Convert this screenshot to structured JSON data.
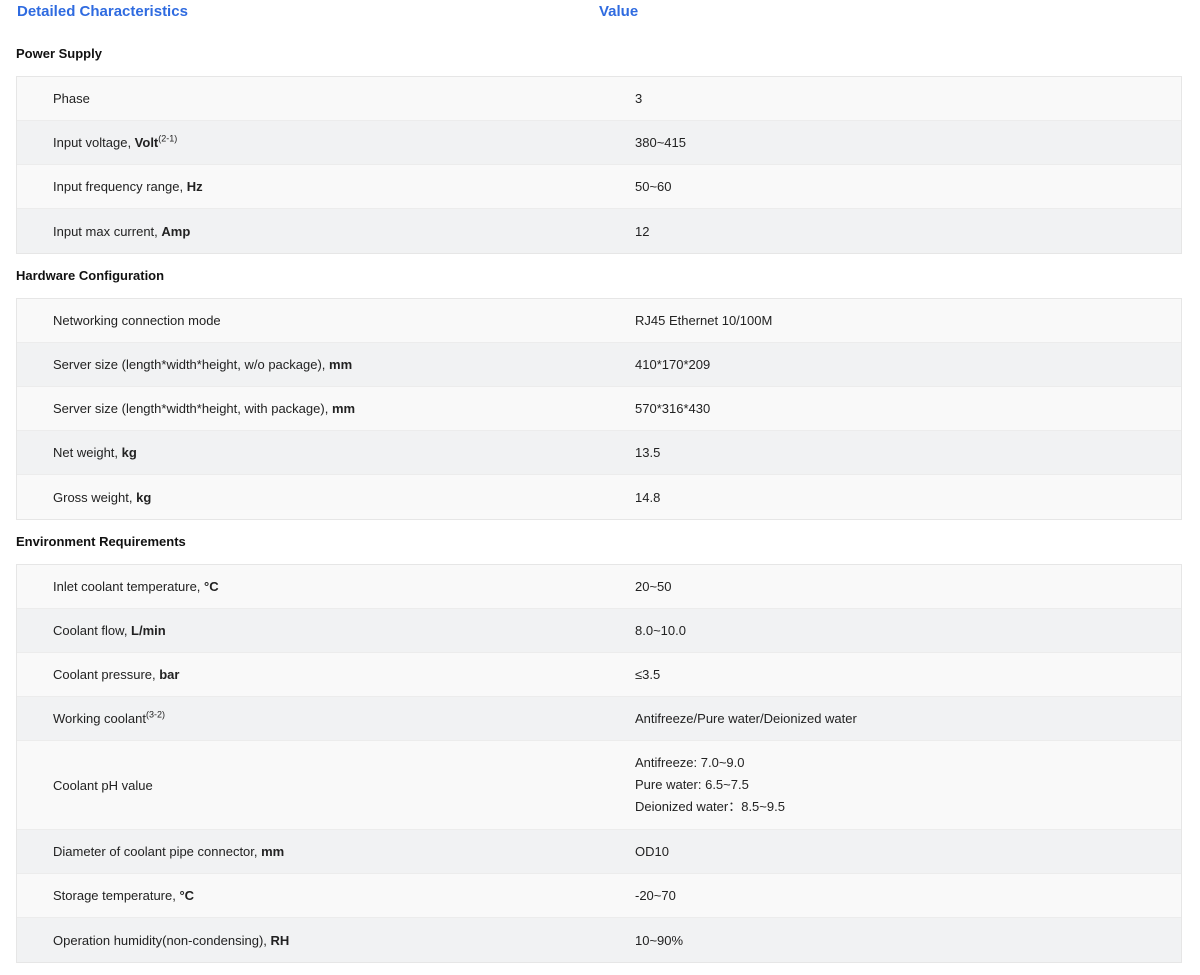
{
  "header": {
    "characteristics_label": "Detailed Characteristics",
    "value_label": "Value"
  },
  "sections": [
    {
      "title": "Power Supply",
      "rows": [
        {
          "label": "Phase",
          "unit": "",
          "sup": "",
          "value": "3"
        },
        {
          "label": "Input voltage, ",
          "unit": "Volt",
          "sup": "(2-1)",
          "value": "380~415"
        },
        {
          "label": "Input frequency range, ",
          "unit": "Hz",
          "sup": "",
          "value": "50~60"
        },
        {
          "label": "Input max current, ",
          "unit": "Amp",
          "sup": "",
          "value": "12"
        }
      ]
    },
    {
      "title": "Hardware Configuration",
      "rows": [
        {
          "label": "Networking connection mode",
          "unit": "",
          "sup": "",
          "value": "RJ45 Ethernet 10/100M"
        },
        {
          "label": "Server size (length*width*height, w/o package), ",
          "unit": "mm",
          "sup": "",
          "value": "410*170*209"
        },
        {
          "label": "Server size (length*width*height, with package), ",
          "unit": "mm",
          "sup": "",
          "value": "570*316*430"
        },
        {
          "label": "Net weight, ",
          "unit": "kg",
          "sup": "",
          "value": "13.5"
        },
        {
          "label": "Gross weight, ",
          "unit": "kg",
          "sup": "",
          "value": "14.8"
        }
      ]
    },
    {
      "title": "Environment Requirements",
      "rows": [
        {
          "label": "Inlet coolant temperature, ",
          "unit": "°C",
          "sup": "",
          "value": "20~50"
        },
        {
          "label": "Coolant flow, ",
          "unit": "L/min",
          "sup": "",
          "value": "8.0~10.0"
        },
        {
          "label": "Coolant pressure, ",
          "unit": "bar",
          "sup": "",
          "value": "≤3.5"
        },
        {
          "label": "Working coolant",
          "unit": "",
          "sup": "(3-2)",
          "value": "Antifreeze/Pure water/Deionized water"
        },
        {
          "label": "Coolant pH value",
          "unit": "",
          "sup": "",
          "values": [
            "Antifreeze: 7.0~9.0",
            "Pure water: 6.5~7.5",
            "Deionized water：8.5~9.5"
          ]
        },
        {
          "label": "Diameter of coolant pipe connector, ",
          "unit": "mm",
          "sup": "",
          "value": "OD10"
        },
        {
          "label": "Storage temperature, ",
          "unit": "°C",
          "sup": "",
          "value": "-20~70"
        },
        {
          "label": "Operation humidity(non-condensing), ",
          "unit": "RH",
          "sup": "",
          "value": "10~90%"
        }
      ]
    }
  ]
}
